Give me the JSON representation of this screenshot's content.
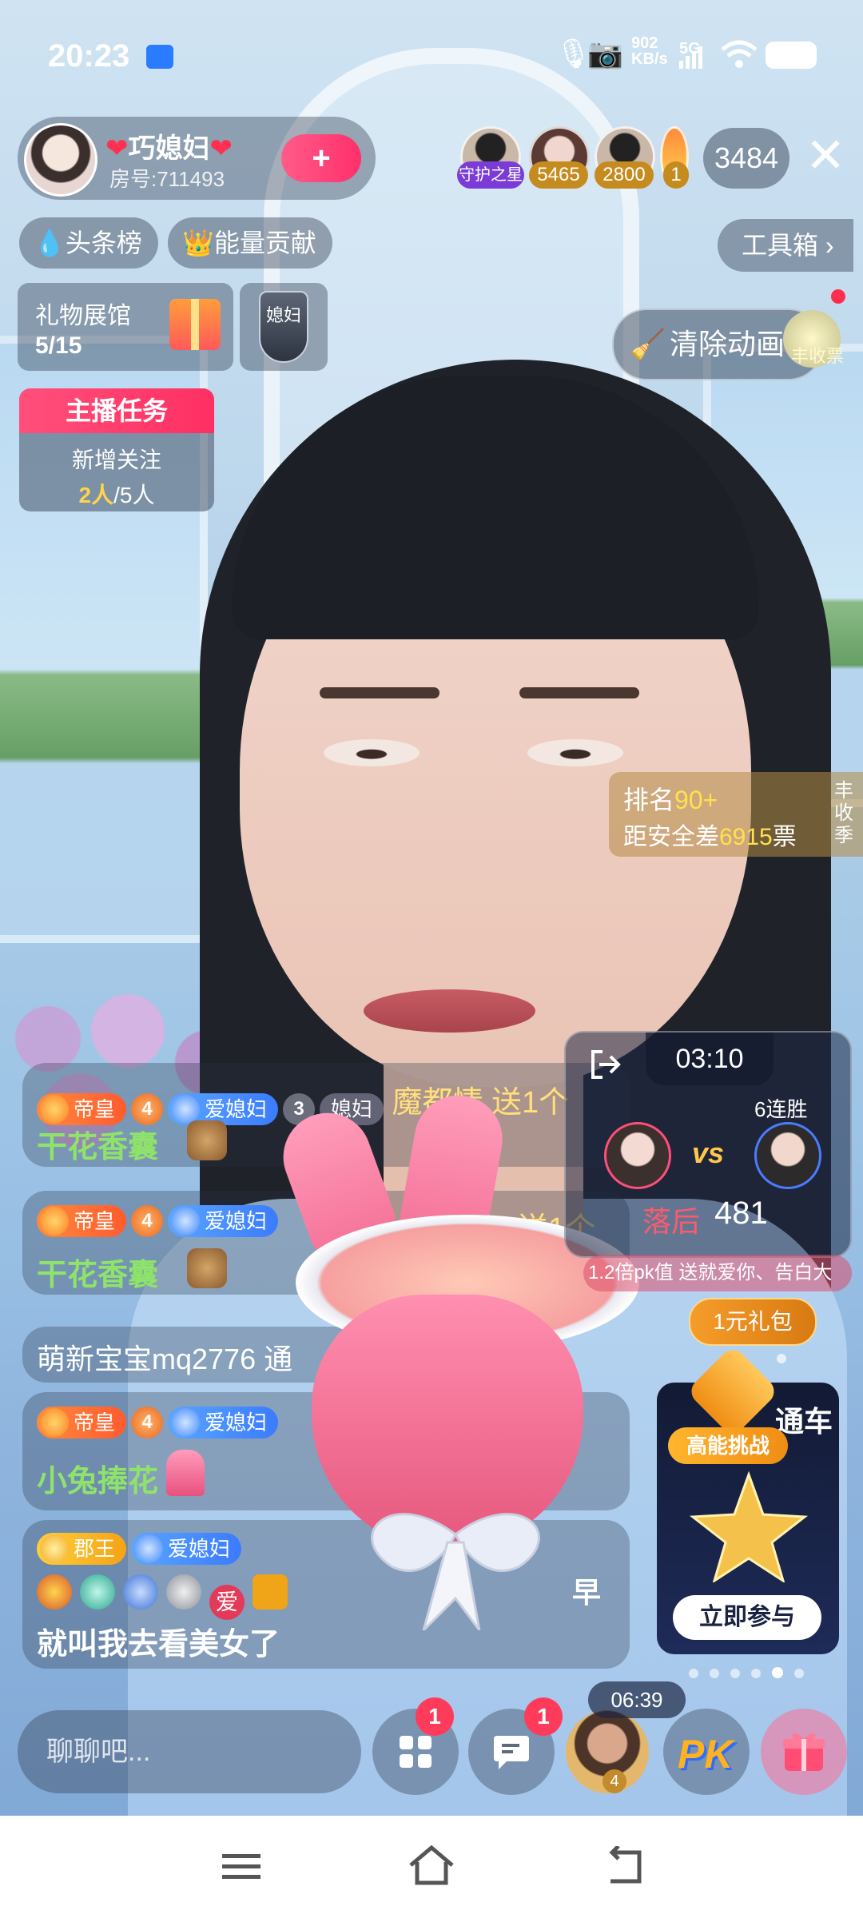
{
  "status": {
    "time": "20:23",
    "net_speed": "902\nKB/s",
    "signal": "5G"
  },
  "host": {
    "name": "巧媳妇",
    "room": "房号:711493",
    "follow": "+"
  },
  "top_right": {
    "viewer_badges": [
      {
        "label": "守护之星",
        "color": "#7b3bd6"
      },
      {
        "label": "5465",
        "color": "#c58b1e"
      },
      {
        "label": "2800",
        "color": "#c58b1e"
      },
      {
        "label": "1",
        "color": "#c58b1e"
      }
    ],
    "viewer_count": "3484",
    "close": "✕"
  },
  "chips": {
    "headline": "头条榜",
    "energy": "能量贡献",
    "toolbox": "工具箱 ›"
  },
  "gift_hall": {
    "title": "礼物展馆",
    "progress": "5/15"
  },
  "fan_badge": {
    "text": "媳妇"
  },
  "clear_anim": "清除动画",
  "autumn": "丰收票",
  "task": {
    "title": "主播任务",
    "desc": "新增关注",
    "done": "2人",
    "total": "/5人"
  },
  "rank": {
    "label": "排名",
    "value": "90+",
    "gap_label": "距安全差",
    "gap": "6915",
    "unit": "票",
    "side": "丰\n收\n季"
  },
  "chat": {
    "rows": [
      {
        "badges": [
          "帝皇",
          "4",
          "爱媳妇",
          "3",
          "媳妇"
        ],
        "sender": "魔都情 送1个",
        "gift": "干花香囊"
      },
      {
        "badges": [
          "帝皇",
          "4",
          "爱媳妇"
        ],
        "sender": "送1个",
        "gift": "干花香囊"
      },
      {
        "text": "萌新宝宝mq2776 通"
      },
      {
        "badges": [
          "帝皇",
          "4",
          "爱媳妇"
        ],
        "gift": "小兔捧花"
      },
      {
        "badges": [
          "郡王",
          "爱媳妇"
        ],
        "extra": "爱",
        "greet": "早",
        "text": "就叫我去看美女了"
      }
    ]
  },
  "pk": {
    "timer": "03:10",
    "streak": "6连胜",
    "vs": "vs",
    "status": "落后",
    "score": "481",
    "marquee": "1.2倍pk值  送就爱你、告白大"
  },
  "promo": {
    "one_yuan": "1元礼包",
    "title": "通车",
    "challenge": "高能挑战",
    "join": "立即参与"
  },
  "bottom": {
    "input_placeholder": "聊聊吧...",
    "apps_badge": "1",
    "msg_badge": "1",
    "timer": "06:39",
    "avatar_level": "4",
    "pk": "PK"
  },
  "colors": {
    "accent": "#ff3b6b",
    "gift_green": "#8fe36a",
    "gold": "#ffd34d"
  }
}
